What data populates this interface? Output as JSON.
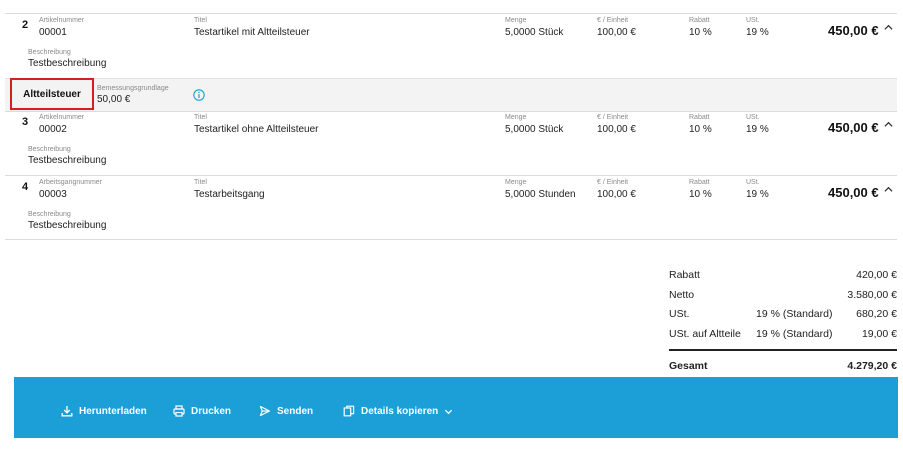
{
  "items": [
    {
      "position": "2",
      "number_label": "Artikelnummer",
      "number": "00001",
      "title_label": "Titel",
      "title": "Testartikel mit Altteilsteuer",
      "qty_label": "Menge",
      "qty": "5,0000 Stück",
      "unit_price_label": "€ / Einheit",
      "unit_price": "100,00 €",
      "discount_label": "Rabatt",
      "discount": "10 %",
      "vat_label": "USt.",
      "vat": "19 %",
      "total": "450,00 €",
      "description_label": "Beschreibung",
      "description": "Testbeschreibung"
    },
    {
      "position": "3",
      "number_label": "Artikelnummer",
      "number": "00002",
      "title_label": "Titel",
      "title": "Testartikel ohne Altteilsteuer",
      "qty_label": "Menge",
      "qty": "5,0000 Stück",
      "unit_price_label": "€ / Einheit",
      "unit_price": "100,00 €",
      "discount_label": "Rabatt",
      "discount": "10 %",
      "vat_label": "USt.",
      "vat": "19 %",
      "total": "450,00 €",
      "description_label": "Beschreibung",
      "description": "Testbeschreibung"
    },
    {
      "position": "4",
      "number_label": "Arbeitsgangnummer",
      "number": "00003",
      "title_label": "Titel",
      "title": "Testarbeitsgang",
      "qty_label": "Menge",
      "qty": "5,0000 Stunden",
      "unit_price_label": "€ / Einheit",
      "unit_price": "100,00 €",
      "discount_label": "Rabatt",
      "discount": "10 %",
      "vat_label": "USt.",
      "vat": "19 %",
      "total": "450,00 €",
      "description_label": "Beschreibung",
      "description": "Testbeschreibung"
    }
  ],
  "subtax": {
    "label": "Altteilsteuer",
    "base_label": "Bemessungsgrundlage",
    "base_value": "50,00 €",
    "info_icon": "info-circle-icon"
  },
  "totals": {
    "discount_label": "Rabatt",
    "discount_value": "420,00 €",
    "net_label": "Netto",
    "net_value": "3.580,00 €",
    "vat_label": "USt.",
    "vat_rate": "19 % (Standard)",
    "vat_value": "680,20 €",
    "oldparts_vat_label": "USt. auf Altteile",
    "oldparts_vat_rate": "19 % (Standard)",
    "oldparts_vat_value": "19,00 €",
    "grand_label": "Gesamt",
    "grand_value": "4.279,20 €"
  },
  "footer": {
    "download_label": "Herunterladen",
    "print_label": "Drucken",
    "send_label": "Senden",
    "copy_label": "Details kopieren"
  },
  "colors": {
    "footer_bg": "#1b9fd6",
    "highlight_border": "#d61f1f",
    "info_icon": "#1b9fd6"
  },
  "icons": {
    "collapse": "chevron-up-icon",
    "download": "download-icon",
    "print": "printer-icon",
    "send": "send-icon",
    "copy": "copy-icon",
    "dropdown": "chevron-down-icon"
  }
}
